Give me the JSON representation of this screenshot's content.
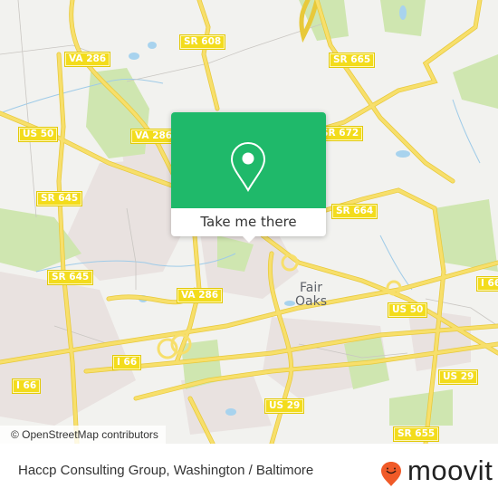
{
  "map": {
    "colors": {
      "background": "#f2f2ef",
      "road": "#f7df6b",
      "road_casing": "#e8c93a",
      "park": "#cfe6b0",
      "urban": "#e9e2e0",
      "water": "#a8d3ee",
      "shield": "#f3dc1c"
    },
    "road_labels": [
      {
        "id": "va286-top",
        "text": "VA 286"
      },
      {
        "id": "sr608",
        "text": "SR 608"
      },
      {
        "id": "sr665",
        "text": "SR 665"
      },
      {
        "id": "us50-left",
        "text": "US 50"
      },
      {
        "id": "va286-mid",
        "text": "VA 286"
      },
      {
        "id": "sr672",
        "text": "SR 672"
      },
      {
        "id": "sr645-top",
        "text": "SR 645"
      },
      {
        "id": "sr664",
        "text": "SR 664"
      },
      {
        "id": "sr645-bottom",
        "text": "SR 645"
      },
      {
        "id": "va286-low",
        "text": "VA 286"
      },
      {
        "id": "i66-right",
        "text": "I 66"
      },
      {
        "id": "us50-right",
        "text": "US 50"
      },
      {
        "id": "i66-center",
        "text": "I 66"
      },
      {
        "id": "i66-left",
        "text": "I 66"
      },
      {
        "id": "us29-right",
        "text": "US 29"
      },
      {
        "id": "us29-center",
        "text": "US 29"
      },
      {
        "id": "sr655",
        "text": "SR 655"
      }
    ],
    "places": [
      {
        "id": "fair-oaks",
        "text": "Fair\nOaks"
      }
    ],
    "attribution": "© OpenStreetMap contributors"
  },
  "popup": {
    "icon": "location-pin-icon",
    "button_label": "Take me there",
    "accent": "#1fb96a"
  },
  "footer": {
    "title": "Haccp Consulting Group, Washington / Baltimore",
    "logo_text": "moovit",
    "logo_color": "#f05a28"
  }
}
